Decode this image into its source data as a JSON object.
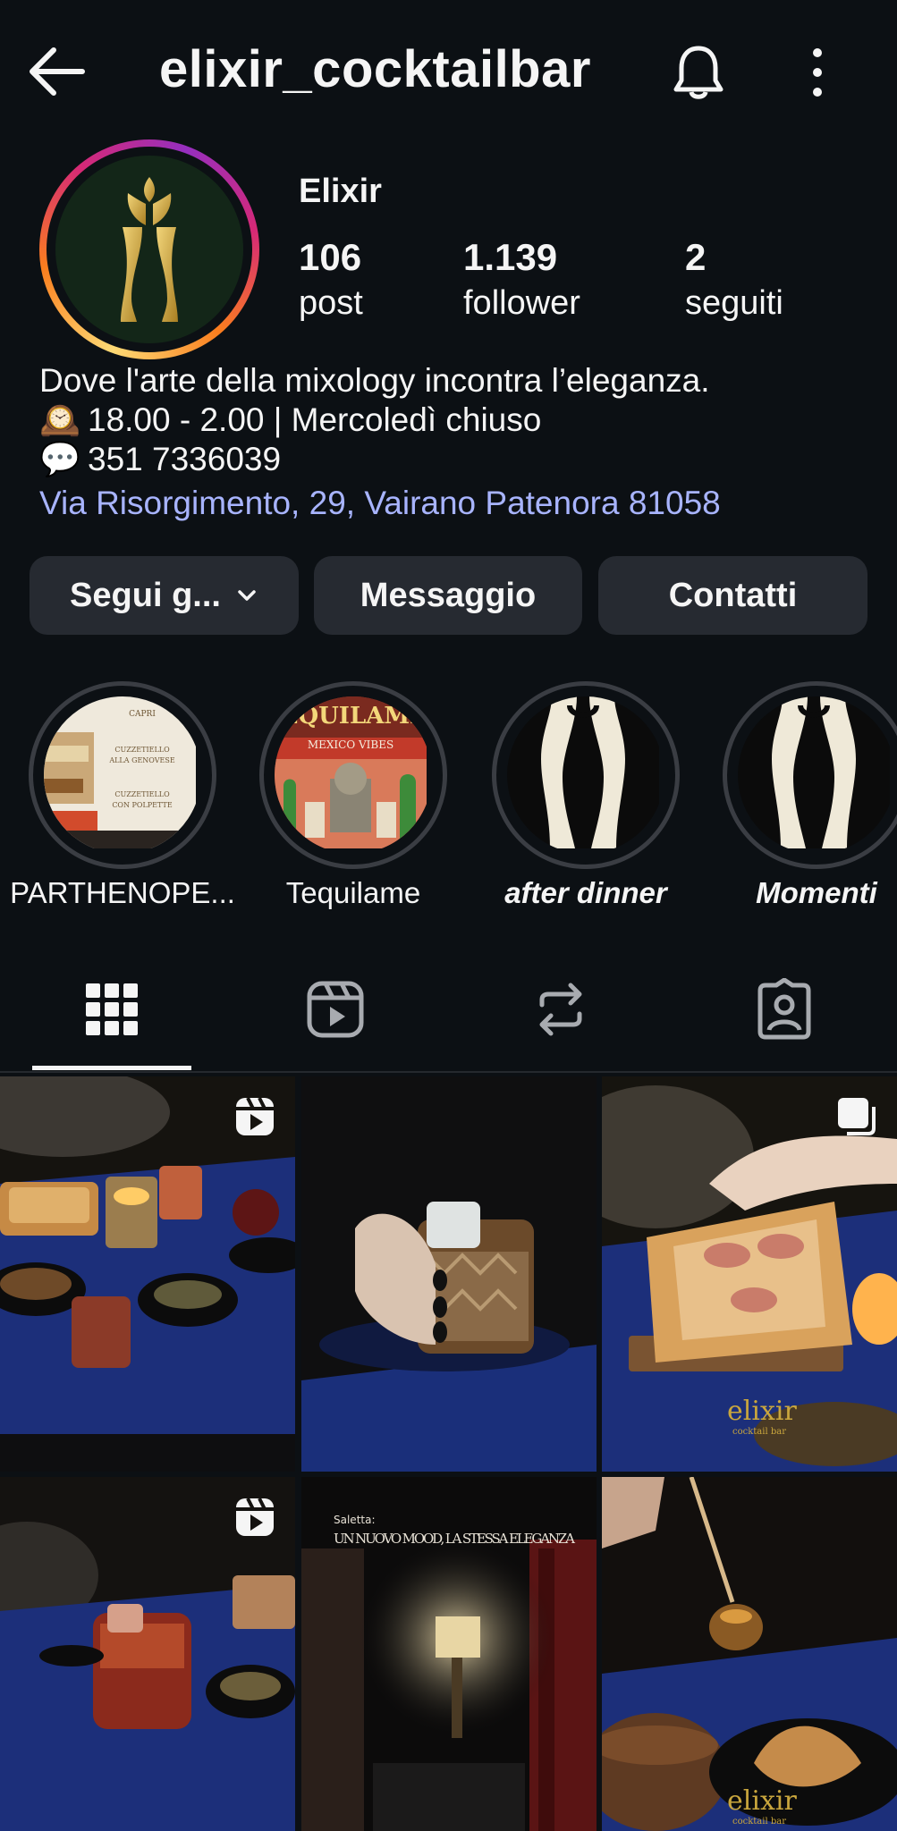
{
  "header": {
    "username": "elixir_cocktailbar",
    "icons": [
      "back-arrow-icon",
      "bell-icon",
      "more-vertical-icon"
    ]
  },
  "profile": {
    "display_name": "Elixir",
    "stats": [
      {
        "num": "106",
        "label": "post"
      },
      {
        "num": "1.139",
        "label": "follower"
      },
      {
        "num": "2",
        "label": "seguiti"
      }
    ],
    "bio": {
      "line1": "Dove l'arte della mixology incontra l’eleganza.",
      "line2_emoji": "🕰️",
      "line2": "18.00 - 2.00 | Mercoledì chiuso",
      "line3_emoji": "💬",
      "line3": "351 7336039",
      "address": "Via Risorgimento, 29, Vairano Patenora 81058"
    }
  },
  "actions": {
    "follow": "Segui g...",
    "message": "Messaggio",
    "contacts": "Contatti"
  },
  "highlights": [
    {
      "label": "PARTHENOPE..."
    },
    {
      "label": "Tequilame"
    },
    {
      "label": "after dinner"
    },
    {
      "label": "Momenti"
    }
  ],
  "highlight_art": {
    "menu_items": [
      "CAPRI",
      "CUZZETIELLO",
      "ALLA GENOVESE",
      "CUZZETIELLO",
      "CON POLPETTE"
    ],
    "tequilame_title": "EQUILAMI",
    "tequilame_sub": "MEXICO VIBES"
  },
  "tabs": [
    "grid-icon",
    "reels-icon",
    "reposts-icon",
    "tagged-icon"
  ],
  "posts": {
    "overlay_small": "Saletta:",
    "overlay_big": "UN NUOVO MOOD, LA STESSA ELEGANZA",
    "brand_mark": "elixir",
    "brand_sub": "cocktail bar"
  },
  "colors": {
    "background": "#0c1014",
    "button": "#262a31",
    "link": "#a8b4ff",
    "table_blue": "#1c2f7a",
    "gold": "#c9a63d"
  }
}
